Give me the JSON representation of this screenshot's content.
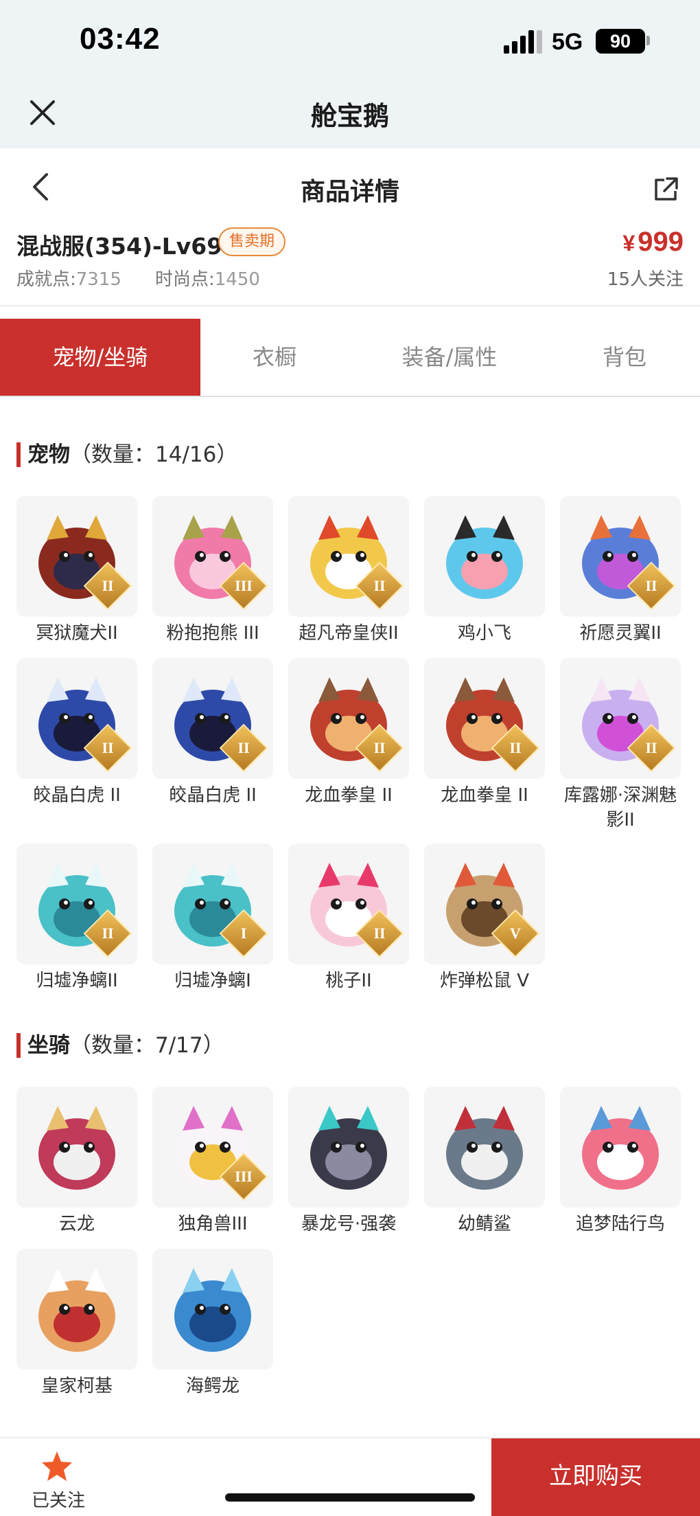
{
  "status": {
    "time": "03:42",
    "network": "5G",
    "battery": "90"
  },
  "app": {
    "title": "舱宝鹅"
  },
  "nav": {
    "title": "商品详情"
  },
  "product": {
    "name": "混战服(354)-Lv69",
    "badge": "售卖期",
    "currency": "¥",
    "price": "999",
    "achievement_label": "成就点:",
    "achievement_value": "7315",
    "fashion_label": "时尚点:",
    "fashion_value": "1450",
    "watchers": "15人关注"
  },
  "tabs": [
    {
      "label": "宠物/坐骑",
      "active": true
    },
    {
      "label": "衣橱",
      "active": false
    },
    {
      "label": "装备/属性",
      "active": false
    },
    {
      "label": "背包",
      "active": false
    }
  ],
  "pets": {
    "title": "宠物",
    "count": "（数量：14/16）",
    "items": [
      {
        "name": "冥狱魔犬II",
        "rank": "II",
        "icon": "dark-dog-icon"
      },
      {
        "name": "粉抱抱熊 III",
        "rank": "III",
        "icon": "pink-bear-icon"
      },
      {
        "name": "超凡帝皇侠II",
        "rank": "II",
        "icon": "golden-hero-icon"
      },
      {
        "name": "鸡小飞",
        "rank": "",
        "icon": "blue-chick-icon"
      },
      {
        "name": "祈愿灵翼II",
        "rank": "II",
        "icon": "wing-bird-icon"
      },
      {
        "name": "皎晶白虎 II",
        "rank": "II",
        "icon": "white-tiger-icon"
      },
      {
        "name": "皎晶白虎 II",
        "rank": "II",
        "icon": "white-tiger-icon"
      },
      {
        "name": "龙血拳皇 II",
        "rank": "II",
        "icon": "red-dragon-icon"
      },
      {
        "name": "龙血拳皇 II",
        "rank": "II",
        "icon": "red-dragon-icon"
      },
      {
        "name": "库露娜·深渊魅影II",
        "rank": "II",
        "icon": "abyss-fairy-icon"
      },
      {
        "name": "归墟净螭II",
        "rank": "II",
        "icon": "cyan-dragon-icon"
      },
      {
        "name": "归墟净螭I",
        "rank": "I",
        "icon": "cyan-dragon-icon"
      },
      {
        "name": "桃子II",
        "rank": "II",
        "icon": "pink-bunny-icon"
      },
      {
        "name": "炸弹松鼠 V",
        "rank": "V",
        "icon": "bomb-squirrel-icon"
      }
    ]
  },
  "mounts": {
    "title": "坐骑",
    "count": "（数量：7/17）",
    "items": [
      {
        "name": "云龙",
        "rank": "",
        "icon": "cloud-dragon-icon"
      },
      {
        "name": "独角兽III",
        "rank": "III",
        "icon": "unicorn-icon"
      },
      {
        "name": "暴龙号·强袭",
        "rank": "",
        "icon": "mecha-rex-icon"
      },
      {
        "name": "幼鲭鲨",
        "rank": "",
        "icon": "shark-icon"
      },
      {
        "name": "追梦陆行鸟",
        "rank": "",
        "icon": "dodo-bird-icon"
      },
      {
        "name": "皇家柯基",
        "rank": "",
        "icon": "royal-corgi-icon"
      },
      {
        "name": "海鳄龙",
        "rank": "",
        "icon": "sea-dragon-icon"
      }
    ]
  },
  "bottom": {
    "follow_label": "已关注",
    "buy_label": "立即购买"
  },
  "colors": {
    "accent": "#c9302c",
    "badge": "#e07126",
    "star": "#f05a28"
  }
}
